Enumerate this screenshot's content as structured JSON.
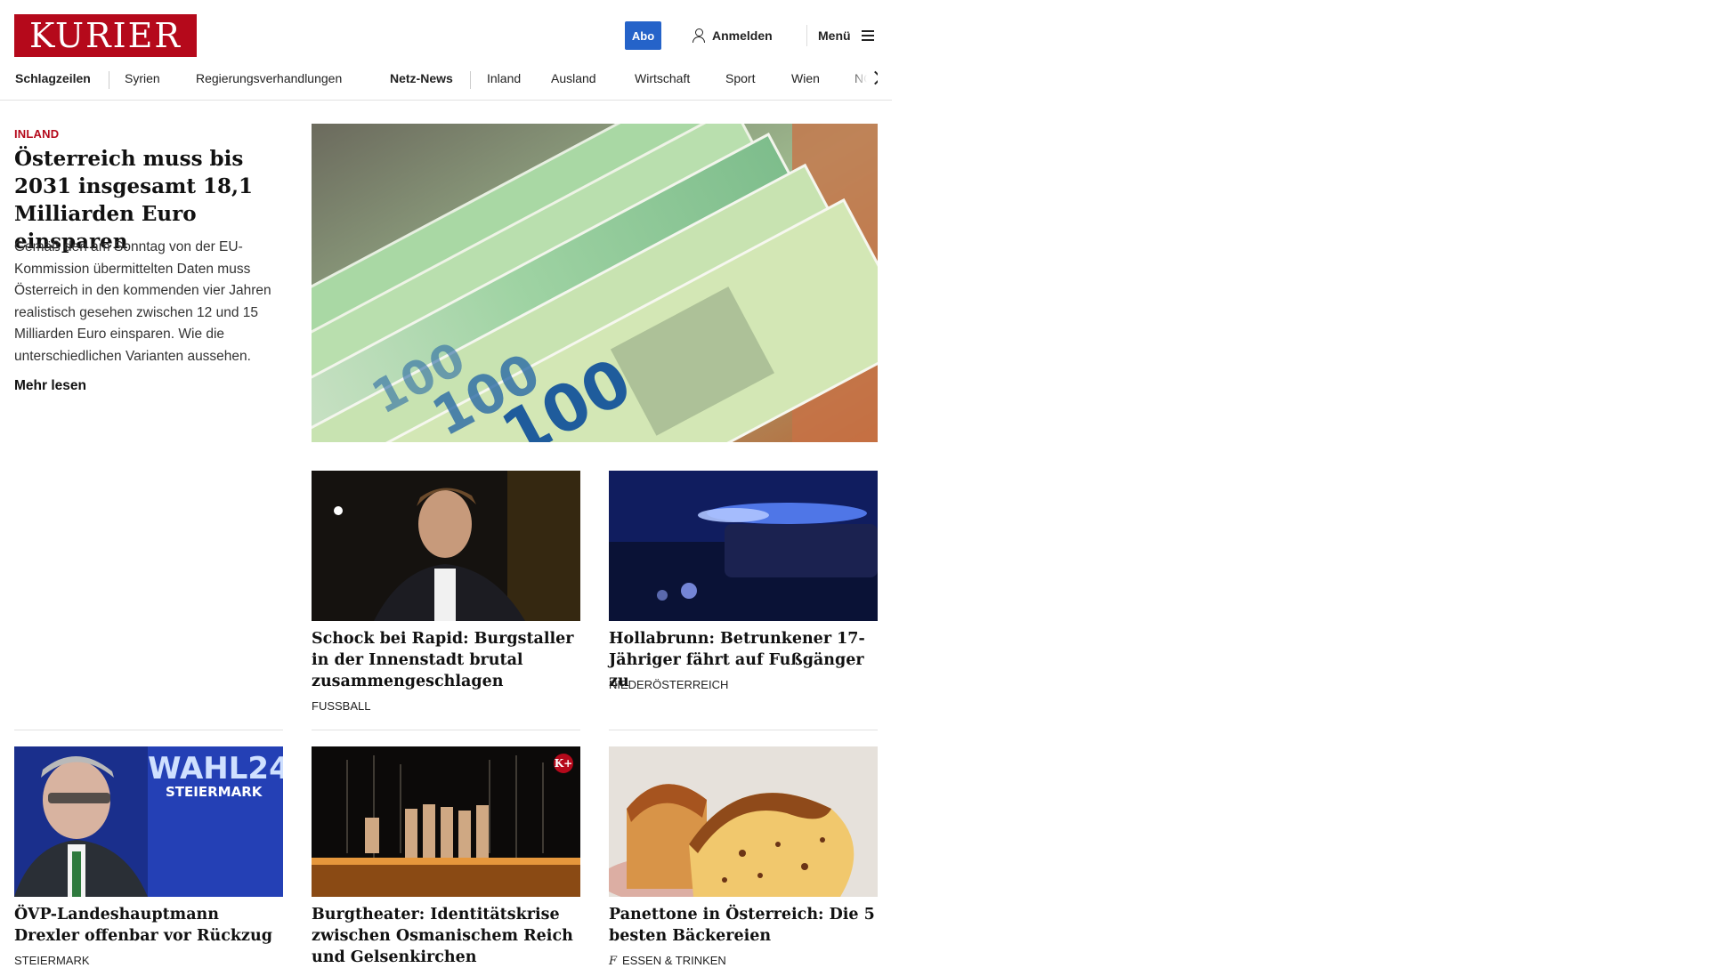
{
  "header": {
    "logo_text": "KURIER",
    "abo_label": "Abo",
    "login_label": "Anmelden",
    "menu_label": "Menü"
  },
  "nav": {
    "items": [
      "Schlagzeilen",
      "Syrien",
      "Regierungsverhandlungen",
      "Netz-News",
      "Inland",
      "Ausland",
      "Wirtschaft",
      "Sport",
      "Wien",
      "NÖ"
    ]
  },
  "lead": {
    "kicker": "INLAND",
    "title": "Österreich muss bis 2031 insgesamt 18,1 Milliarden Euro einsparen",
    "text": "Gemäß den am Sonntag von der EU-Kommission übermittelten Daten muss Österreich in den kommenden vier Jahren realistisch gesehen zwischen 12 und 15 Milliarden Euro einsparen. Wie die unterschiedlichen Varianten aussehen.",
    "more": "Mehr lesen"
  },
  "cards": [
    {
      "title": "Schock bei Rapid: Burgstaller in der Innenstadt brutal zusammengeschlagen",
      "kicker": "FUSSBALL"
    },
    {
      "title": "Hollabrunn: Betrunkener 17-Jähri­ger fährt auf Fußgänger zu",
      "kicker": "NIEDERÖSTERREICH"
    },
    {
      "title": "ÖVP-Landeshauptmann Drexler offenbar vor Rückzug",
      "kicker": "STEIERMARK",
      "image_text_1": "WAHL24",
      "image_text_2": "STEIERMARK"
    },
    {
      "title": "Burgtheater: Identitätskrise zwi­schen Osmanischem Reich und Gelsenkirchen",
      "kicker": "",
      "badge": "K+"
    },
    {
      "title": "Panettone in Österreich: Die 5 bes­ten Bäckereien",
      "kicker": "ESSEN & TRINKEN",
      "kicker_icon": "f"
    }
  ],
  "colors": {
    "brand": "#b5091b",
    "abo": "#2563c9"
  }
}
